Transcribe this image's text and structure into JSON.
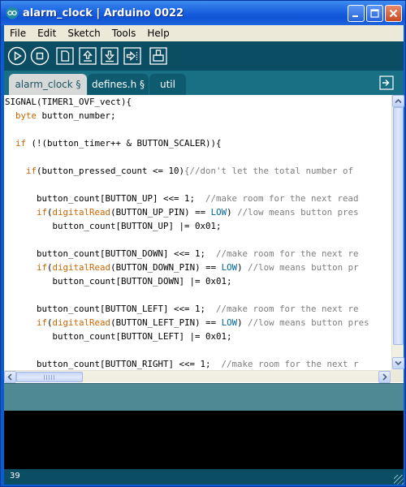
{
  "window": {
    "title": "alarm_clock | Arduino 0022",
    "controls": [
      "minimize",
      "maximize",
      "close"
    ]
  },
  "menu": [
    "File",
    "Edit",
    "Sketch",
    "Tools",
    "Help"
  ],
  "toolbar": {
    "buttons": [
      "verify",
      "stop",
      "new",
      "open",
      "save",
      "upload",
      "serial-monitor"
    ]
  },
  "tabs": [
    {
      "label": "alarm_clock §",
      "active": true
    },
    {
      "label": "defines.h §",
      "active": false
    },
    {
      "label": "util",
      "active": false
    }
  ],
  "editor": {
    "lines": [
      {
        "indent": "",
        "parts": [
          {
            "t": "SIGNAL(TIMER1_OVF_vect){",
            "c": ""
          }
        ]
      },
      {
        "indent": "  ",
        "parts": [
          {
            "t": "byte",
            "c": "kw"
          },
          {
            "t": " button_number;",
            "c": ""
          }
        ]
      },
      {
        "indent": "",
        "parts": [
          {
            "t": "",
            "c": ""
          }
        ]
      },
      {
        "indent": "  ",
        "parts": [
          {
            "t": "if",
            "c": "kw"
          },
          {
            "t": " (!(button_timer++ & BUTTON_SCALER)){",
            "c": ""
          }
        ]
      },
      {
        "indent": "",
        "parts": [
          {
            "t": "",
            "c": ""
          }
        ]
      },
      {
        "indent": "    ",
        "parts": [
          {
            "t": "if",
            "c": "kw"
          },
          {
            "t": "(button_pressed_count <= 10)",
            "c": ""
          },
          {
            "t": "{//don't let the total number of",
            "c": "cm"
          }
        ]
      },
      {
        "indent": "",
        "parts": [
          {
            "t": "",
            "c": ""
          }
        ]
      },
      {
        "indent": "      ",
        "parts": [
          {
            "t": "button_count[BUTTON_UP] <<= 1;  ",
            "c": ""
          },
          {
            "t": "//make room for the next read",
            "c": "cm"
          }
        ]
      },
      {
        "indent": "      ",
        "parts": [
          {
            "t": "if",
            "c": "kw"
          },
          {
            "t": "(",
            "c": ""
          },
          {
            "t": "digitalRead",
            "c": "fn"
          },
          {
            "t": "(BUTTON_UP_PIN) == ",
            "c": ""
          },
          {
            "t": "LOW",
            "c": "cst"
          },
          {
            "t": ") ",
            "c": ""
          },
          {
            "t": "//low means button pres",
            "c": "cm"
          }
        ]
      },
      {
        "indent": "         ",
        "parts": [
          {
            "t": "button_count[BUTTON_UP] |= 0x01;",
            "c": ""
          }
        ]
      },
      {
        "indent": "",
        "parts": [
          {
            "t": "",
            "c": ""
          }
        ]
      },
      {
        "indent": "      ",
        "parts": [
          {
            "t": "button_count[BUTTON_DOWN] <<= 1;  ",
            "c": ""
          },
          {
            "t": "//make room for the next re",
            "c": "cm"
          }
        ]
      },
      {
        "indent": "      ",
        "parts": [
          {
            "t": "if",
            "c": "kw"
          },
          {
            "t": "(",
            "c": ""
          },
          {
            "t": "digitalRead",
            "c": "fn"
          },
          {
            "t": "(BUTTON_DOWN_PIN) == ",
            "c": ""
          },
          {
            "t": "LOW",
            "c": "cst"
          },
          {
            "t": ") ",
            "c": ""
          },
          {
            "t": "//low means button pr",
            "c": "cm"
          }
        ]
      },
      {
        "indent": "         ",
        "parts": [
          {
            "t": "button_count[BUTTON_DOWN] |= 0x01;",
            "c": ""
          }
        ]
      },
      {
        "indent": "",
        "parts": [
          {
            "t": "",
            "c": ""
          }
        ]
      },
      {
        "indent": "      ",
        "parts": [
          {
            "t": "button_count[BUTTON_LEFT] <<= 1;  ",
            "c": ""
          },
          {
            "t": "//make room for the next re",
            "c": "cm"
          }
        ]
      },
      {
        "indent": "      ",
        "parts": [
          {
            "t": "if",
            "c": "kw"
          },
          {
            "t": "(",
            "c": ""
          },
          {
            "t": "digitalRead",
            "c": "fn"
          },
          {
            "t": "(BUTTON_LEFT_PIN) == ",
            "c": ""
          },
          {
            "t": "LOW",
            "c": "cst"
          },
          {
            "t": ") ",
            "c": ""
          },
          {
            "t": "//low means button pres",
            "c": "cm"
          }
        ]
      },
      {
        "indent": "         ",
        "parts": [
          {
            "t": "button_count[BUTTON_LEFT] |= 0x01;",
            "c": ""
          }
        ]
      },
      {
        "indent": "",
        "parts": [
          {
            "t": "",
            "c": ""
          }
        ]
      },
      {
        "indent": "      ",
        "parts": [
          {
            "t": "button_count[BUTTON_RIGHT] <<= 1;  ",
            "c": ""
          },
          {
            "t": "//make room for the next r",
            "c": "cm"
          }
        ]
      }
    ]
  },
  "status": {
    "line_number": "39"
  },
  "colors": {
    "titlebar": "#1b63e0",
    "toolbar": "#0b4d63",
    "tabs_row": "#197085",
    "active_tab": "#d7d9d8",
    "keyword": "#cc6600",
    "constant": "#006699",
    "comment": "#7e7e7e",
    "console": "#000000"
  }
}
